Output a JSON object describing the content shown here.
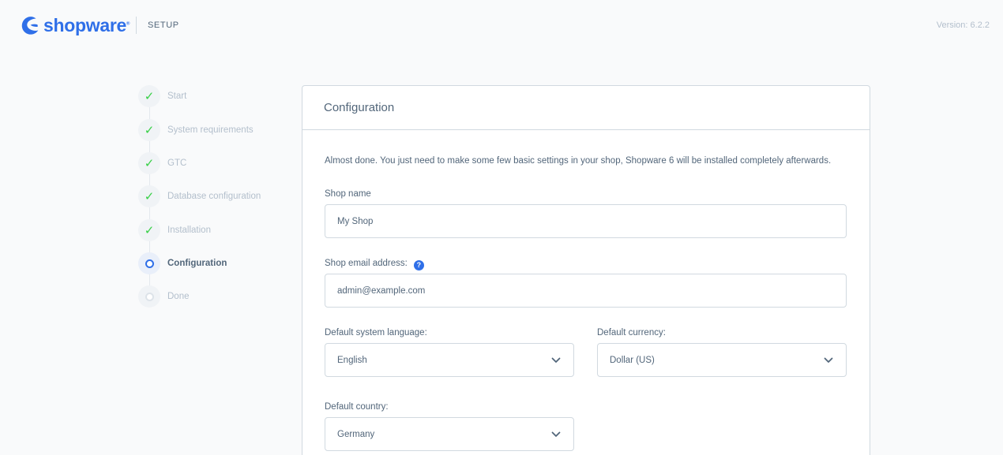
{
  "header": {
    "brand": "shopware",
    "brand_reg": "®",
    "section": "SETUP",
    "version": "Version: 6.2.2"
  },
  "steps": [
    {
      "label": "Start",
      "state": "done"
    },
    {
      "label": "System requirements",
      "state": "done"
    },
    {
      "label": "GTC",
      "state": "done"
    },
    {
      "label": "Database configuration",
      "state": "done"
    },
    {
      "label": "Installation",
      "state": "done"
    },
    {
      "label": "Configuration",
      "state": "active"
    },
    {
      "label": "Done",
      "state": "pending"
    }
  ],
  "icons": {
    "done": "check-icon",
    "active": "active-circle-icon",
    "pending": "pending-circle-icon"
  },
  "colors": {
    "accent": "#2f6fe8",
    "success": "#37d046",
    "text": "#52667a",
    "muted": "#b3bfcc"
  },
  "card": {
    "title": "Configuration",
    "intro": "Almost done. You just need to make some few basic settings in your shop, Shopware 6 will be installed completely afterwards.",
    "shop_name": {
      "label": "Shop name",
      "value": "My Shop"
    },
    "shop_email": {
      "label": "Shop email address:",
      "value": "admin@example.com",
      "help": "?"
    },
    "language": {
      "label": "Default system language:",
      "value": "English"
    },
    "currency": {
      "label": "Default currency:",
      "value": "Dollar (US)"
    },
    "country": {
      "label": "Default country:",
      "value": "Germany"
    }
  }
}
